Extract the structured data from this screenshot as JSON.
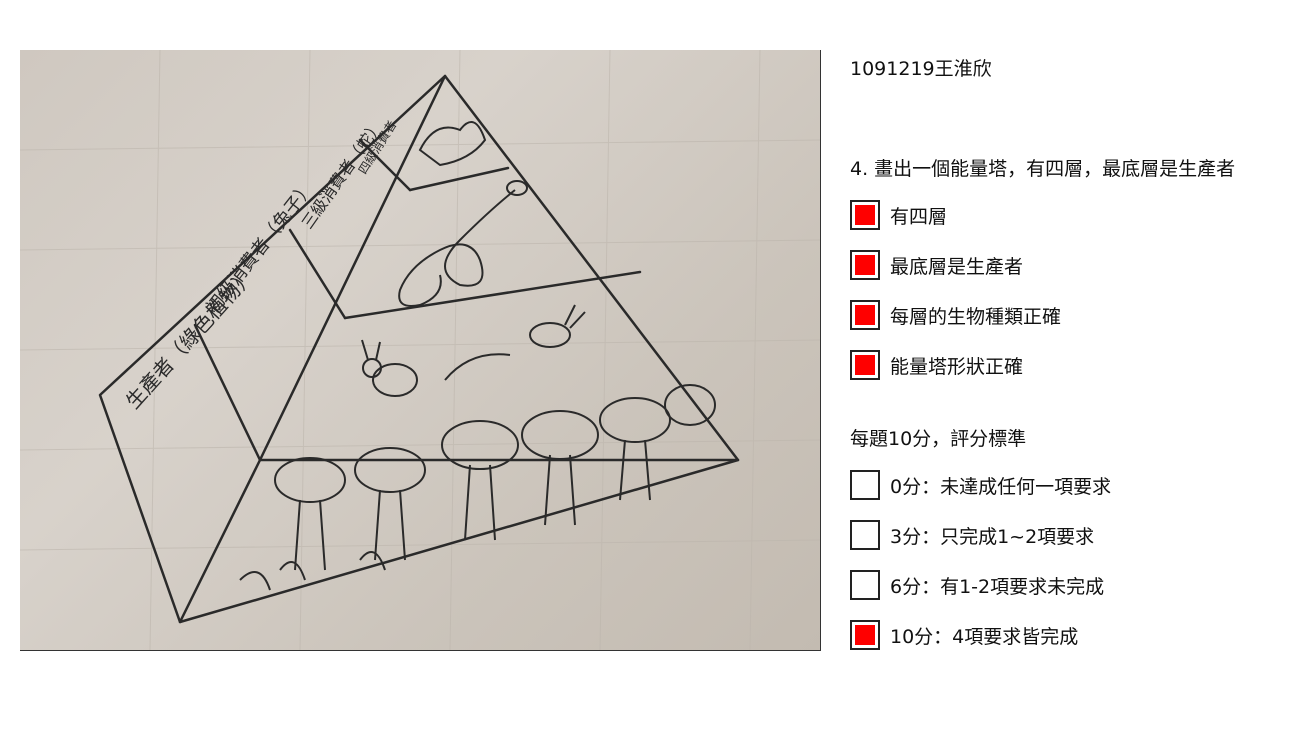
{
  "header": {
    "name_id": "1091219王淮欣"
  },
  "question": {
    "text": "4. 畫出一個能量塔，有四層，最底層是生產者"
  },
  "requirements": [
    {
      "label": "有四層",
      "checked": true
    },
    {
      "label": "最底層是生產者",
      "checked": true
    },
    {
      "label": "每層的生物種類正確",
      "checked": true
    },
    {
      "label": "能量塔形狀正確",
      "checked": true
    }
  ],
  "rubric": {
    "title": "每題10分，評分標準",
    "options": [
      {
        "label": "0分：未達成任何一項要求",
        "checked": false
      },
      {
        "label": "3分：只完成1~2項要求",
        "checked": false
      },
      {
        "label": "6分：有1-2項要求未完成",
        "checked": false
      },
      {
        "label": "10分：4項要求皆完成",
        "checked": true
      }
    ]
  },
  "drawing": {
    "layer_labels": [
      "生產者（綠色植物）",
      "初級消費者（兔子）",
      "三級消費者（蛇）",
      "四級消費者"
    ]
  },
  "colors": {
    "checked": "#ff0000",
    "ink": "#2a2a2a"
  }
}
